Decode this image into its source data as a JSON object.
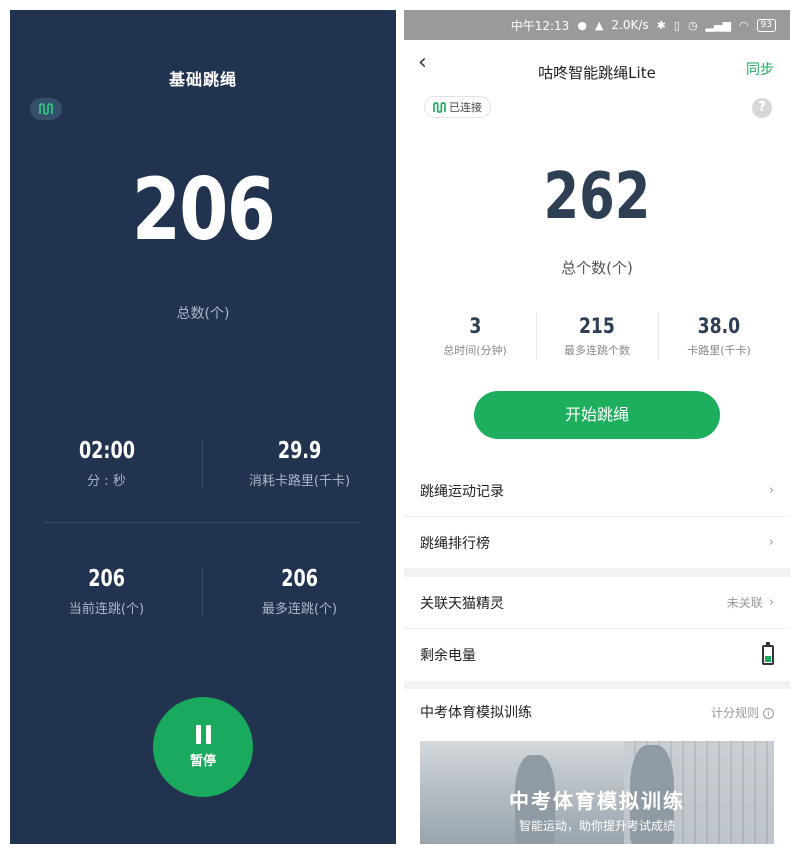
{
  "left": {
    "title": "基础跳绳",
    "connection_icon": "rope-icon",
    "total_count": "206",
    "total_label": "总数(个)",
    "stats": [
      {
        "value": "02:00",
        "label": "分 : 秒"
      },
      {
        "value": "29.9",
        "label": "消耗卡路里(千卡)"
      },
      {
        "value": "206",
        "label": "当前连跳(个)"
      },
      {
        "value": "206",
        "label": "最多连跳(个)"
      }
    ],
    "pause_label": "暂停"
  },
  "right": {
    "status_bar": {
      "time": "中午12:13",
      "speed": "2.0K/s",
      "battery": "93"
    },
    "nav": {
      "back_icon": "chevron-left-icon",
      "title": "咕咚智能跳绳Lite",
      "sync_label": "同步"
    },
    "connection_status": "已连接",
    "total_count": "262",
    "total_label": "总个数(个)",
    "stats": [
      {
        "value": "3",
        "label": "总时间(分钟)"
      },
      {
        "value": "215",
        "label": "最多连跳个数"
      },
      {
        "value": "38.0",
        "label": "卡路里(千卡)"
      }
    ],
    "start_label": "开始跳绳",
    "menu": [
      {
        "label": "跳绳运动记录"
      },
      {
        "label": "跳绳排行榜"
      }
    ],
    "settings": {
      "tmall_label": "关联天猫精灵",
      "tmall_status": "未关联",
      "battery_label": "剩余电量",
      "battery_level": 0.4
    },
    "exam": {
      "label": "中考体育模拟训练",
      "rules_label": "计分规则",
      "banner_title": "中考体育模拟训练",
      "banner_subtitle": "智能运动，助你提升考试成绩"
    },
    "colors": {
      "accent": "#1aaa5d",
      "dark_panel": "#22334f"
    }
  }
}
